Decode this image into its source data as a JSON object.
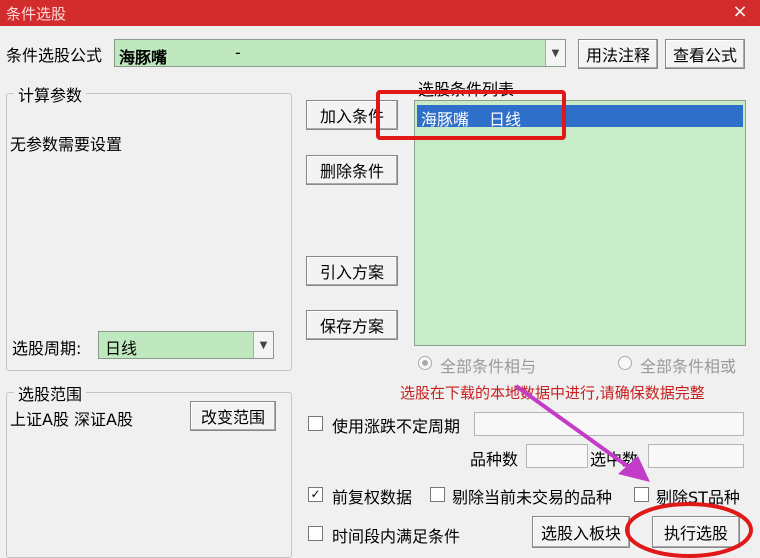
{
  "window": {
    "title": "条件选股",
    "close": "×"
  },
  "formula": {
    "label": "条件选股公式",
    "value": "海豚嘴",
    "dash": "-",
    "usage_btn": "用法注释",
    "view_btn": "查看公式"
  },
  "calc": {
    "group_title": "计算参数",
    "no_param_text": "无参数需要设置",
    "period_label": "选股周期:",
    "period_value": "日线"
  },
  "buttons": {
    "add": "加入条件",
    "delete": "删除条件",
    "import": "引入方案",
    "save": "保存方案"
  },
  "conditions": {
    "list_title": "选股条件列表",
    "items": [
      {
        "name": "海豚嘴",
        "period": "日线"
      }
    ]
  },
  "logic": {
    "all_and": "全部条件相与",
    "all_or": "全部条件相或"
  },
  "warning": "选股在下载的本地数据中进行,请确保数据完整",
  "range": {
    "group_title": "选股范围",
    "value": "上证A股 深证A股",
    "change_btn": "改变范围"
  },
  "options": {
    "use_indef_period": "使用涨跌不定周期",
    "count_label": "品种数",
    "selected_label": "选中数",
    "adjust_label": "前复权数据",
    "exclude_untraded": "剔除当前未交易的品种",
    "exclude_st": "剔除ST品种",
    "time_period": "时间段内满足条件",
    "to_block_btn": "选股入板块",
    "execute_btn": "执行选股"
  },
  "colors": {
    "titlebar": "#d22c2c",
    "annotation_red": "#e01818",
    "arrow": "#c23cc8",
    "warning": "#c81e1e"
  }
}
